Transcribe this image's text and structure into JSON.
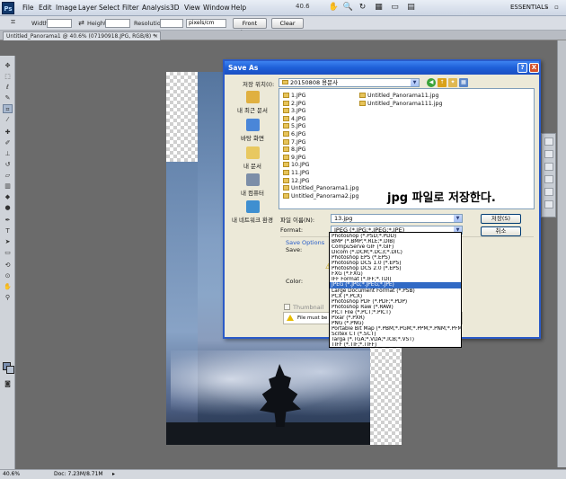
{
  "menubar": {
    "logo": "Ps",
    "items": [
      "File",
      "Edit",
      "Image",
      "Layer",
      "Select",
      "Filter",
      "Analysis",
      "3D",
      "View",
      "Window",
      "Help"
    ],
    "zoom": "40.6",
    "workspace": "ESSENTIALS"
  },
  "options_bar": {
    "width_label": "Width:",
    "height_label": "Height:",
    "resolution_label": "Resolution:",
    "resolution_unit": "pixels/cm",
    "front_image_label": "Front Image",
    "clear_label": "Clear"
  },
  "document_tab": {
    "title": "Untitled_Panorama1 @ 40.6% (07190918.JPG, RGB/8) *"
  },
  "status_bar": {
    "zoom": "40.6%",
    "doc_info": "Doc: 7.23M/8.71M"
  },
  "dialog": {
    "title": "Save As",
    "help": "?",
    "close": "X",
    "save_in_label": "저장 위치(I):",
    "save_in_value": "20150808 용문사",
    "places": [
      {
        "label": "내 최근 문서",
        "color": "#e0b040"
      },
      {
        "label": "바탕 화면",
        "color": "#4a86d8"
      },
      {
        "label": "내 문서",
        "color": "#e8c860"
      },
      {
        "label": "내 컴퓨터",
        "color": "#7c8ea8"
      },
      {
        "label": "내 네트워크 환경",
        "color": "#3f8fd0"
      }
    ],
    "files_col1": [
      "1.JPG",
      "2.JPG",
      "3.JPG",
      "4.JPG",
      "5.JPG",
      "6.JPG",
      "7.JPG",
      "8.JPG",
      "9.JPG",
      "10.JPG",
      "11.JPG",
      "12.JPG",
      "Untitled_Panorama1.jpg",
      "Untitled_Panorama2.jpg"
    ],
    "files_col2": [
      "Untitled_Panorama11.jpg",
      "Untitled_Panorama111.jpg"
    ],
    "annotation": "jpg 파일로 저장한다.",
    "filename_label": "파일 이름(N):",
    "filename_value": "13.jpg",
    "format_label": "Format:",
    "format_value": "JPEG (*.JPG;*.JPEG;*.JPE)",
    "save_button": "저장(S)",
    "cancel_button": "취소",
    "save_options_label": "Save Options",
    "save_label": "Save:",
    "color_label": "Color:",
    "thumbnail_label": "Thumbnail",
    "note_text": "File must be sa"
  },
  "format_options": [
    "Photoshop (*.PSD;*.PDD)",
    "BMP (*.BMP;*.RLE;*.DIB)",
    "CompuServe GIF (*.GIF)",
    "Dicom (*.DCM;*.DC3;*.DIC)",
    "Photoshop EPS (*.EPS)",
    "Photoshop DCS 1.0 (*.EPS)",
    "Photoshop DCS 2.0 (*.EPS)",
    "FXG (*.FXG)",
    "IFF Format (*.IFF;*.TDI)",
    "JPEG (*.JPG;*.JPEG;*.JPE)",
    "Large Document Format (*.PSB)",
    "PCX (*.PCX)",
    "Photoshop PDF (*.PDF;*.PDP)",
    "Photoshop Raw (*.RAW)",
    "PICT File (*.PCT;*.PICT)",
    "Pixar (*.PXR)",
    "PNG (*.PNG)",
    "Portable Bit Map (*.PBM;*.PGM;*.PPM;*.PNM;*.PFM;*.PAM)",
    "Scitex CT (*.SCT)",
    "Targa (*.TGA;*.VDA;*.ICB;*.VST)",
    "TIFF (*.TIF;*.TIFF)"
  ],
  "format_selected_index": 9
}
